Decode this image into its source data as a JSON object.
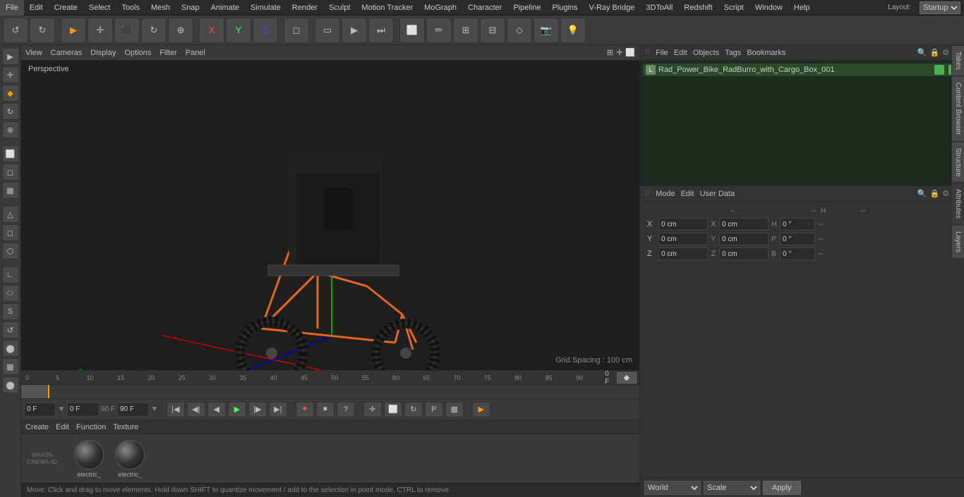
{
  "app": {
    "title": "Cinema 4D"
  },
  "menubar": {
    "items": [
      "File",
      "Edit",
      "Create",
      "Select",
      "Tools",
      "Mesh",
      "Snap",
      "Animate",
      "Simulate",
      "Render",
      "Sculpt",
      "Motion Tracker",
      "MoGraph",
      "Character",
      "Pipeline",
      "Plugins",
      "V-Ray Bridge",
      "3DToAll",
      "Redshift",
      "Script",
      "Window",
      "Help"
    ],
    "layout_label": "Layout:",
    "layout_value": "Startup"
  },
  "viewport": {
    "label": "Perspective",
    "header_items": [
      "View",
      "Cameras",
      "Display",
      "Options",
      "Filter",
      "Panel"
    ],
    "grid_spacing": "Grid Spacing : 100 cm"
  },
  "timeline": {
    "marks": [
      "0",
      "5",
      "10",
      "15",
      "20",
      "25",
      "30",
      "35",
      "40",
      "45",
      "50",
      "55",
      "60",
      "65",
      "70",
      "75",
      "80",
      "85",
      "90"
    ],
    "current_frame": "0 F",
    "end_frame_1": "90 F",
    "end_frame_2": "90 F",
    "frame_field": "0 F"
  },
  "object_manager": {
    "header_items": [
      "File",
      "Edit",
      "Objects",
      "Tags",
      "Bookmarks"
    ],
    "object_name": "Rad_Power_Bike_RadBurro_with_Cargo_Box_001"
  },
  "attributes": {
    "header_items": [
      "Mode",
      "Edit",
      "User Data"
    ],
    "coords": {
      "x_pos": "0 cm",
      "y_pos": "0 cm",
      "z_pos": "0 cm",
      "x_rot": "0 cm",
      "y_rot": "0 cm",
      "z_rot": "0 cm",
      "h": "0 °",
      "p": "0 °",
      "b": "0 °"
    }
  },
  "bottom_controls": {
    "world_label": "World",
    "scale_label": "Scale",
    "apply_label": "Apply"
  },
  "materials": {
    "header_items": [
      "Create",
      "Edit",
      "Function",
      "Texture"
    ],
    "items": [
      {
        "label": "electric_"
      },
      {
        "label": "electric_"
      }
    ]
  },
  "status_bar": {
    "text": "Move: Click and drag to move elements. Hold down SHIFT to quantize movement / add to the selection in point mode, CTRL to remove."
  },
  "right_vtabs": [
    "Takes",
    "Content Browser",
    "Structure",
    "Attributes",
    "Layers"
  ],
  "toolbar": {
    "undo_icon": "↺",
    "redo_icon": "↻"
  }
}
